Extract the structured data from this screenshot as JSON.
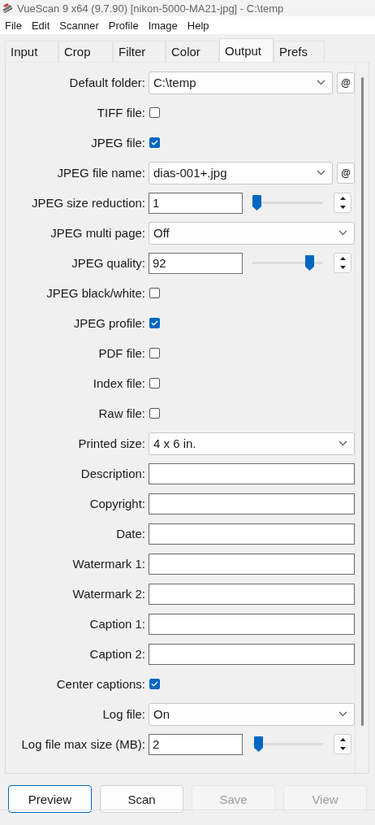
{
  "window": {
    "title": "VueScan 9 x64 (9.7.90) [nikon-5000-MA21-jpg] - C:\\temp"
  },
  "menu": [
    "File",
    "Edit",
    "Scanner",
    "Profile",
    "Image",
    "Help"
  ],
  "tabs": [
    {
      "label": "Input",
      "selected": false
    },
    {
      "label": "Crop",
      "selected": false
    },
    {
      "label": "Filter",
      "selected": false
    },
    {
      "label": "Color",
      "selected": false
    },
    {
      "label": "Output",
      "selected": true
    },
    {
      "label": "Prefs",
      "selected": false
    }
  ],
  "fields": [
    {
      "kind": "select",
      "label": "Default folder:",
      "value": "C:\\temp",
      "side_button": "@"
    },
    {
      "kind": "checkbox",
      "label": "TIFF file:",
      "checked": false
    },
    {
      "kind": "checkbox",
      "label": "JPEG file:",
      "checked": true
    },
    {
      "kind": "select",
      "label": "JPEG file name:",
      "value": "dias-001+.jpg",
      "side_button": "@"
    },
    {
      "kind": "number",
      "label": "JPEG size reduction:",
      "value": "1",
      "level": 0
    },
    {
      "kind": "select",
      "label": "JPEG multi page:",
      "value": "Off"
    },
    {
      "kind": "number",
      "label": "JPEG quality:",
      "value": "92",
      "level": 0.86
    },
    {
      "kind": "checkbox",
      "label": "JPEG black/white:",
      "checked": false
    },
    {
      "kind": "checkbox",
      "label": "JPEG profile:",
      "checked": true
    },
    {
      "kind": "checkbox",
      "label": "PDF file:",
      "checked": false
    },
    {
      "kind": "checkbox",
      "label": "Index file:",
      "checked": false
    },
    {
      "kind": "checkbox",
      "label": "Raw file:",
      "checked": false
    },
    {
      "kind": "select",
      "label": "Printed size:",
      "value": "4 x 6 in."
    },
    {
      "kind": "text",
      "label": "Description:"
    },
    {
      "kind": "text",
      "label": "Copyright:"
    },
    {
      "kind": "text",
      "label": "Date:"
    },
    {
      "kind": "text",
      "label": "Watermark 1:"
    },
    {
      "kind": "text",
      "label": "Watermark 2:"
    },
    {
      "kind": "text",
      "label": "Caption 1:"
    },
    {
      "kind": "text",
      "label": "Caption 2:"
    },
    {
      "kind": "checkbox",
      "label": "Center captions:",
      "checked": true
    },
    {
      "kind": "select",
      "label": "Log file:",
      "value": "On"
    },
    {
      "kind": "number",
      "label": "Log file max size (MB):",
      "value": "2",
      "level": 0.02
    }
  ],
  "buttons": [
    {
      "label": "Preview",
      "focused": true,
      "disabled": false
    },
    {
      "label": "Scan",
      "focused": false,
      "disabled": false
    },
    {
      "label": "Save",
      "focused": false,
      "disabled": true
    },
    {
      "label": "View",
      "focused": false,
      "disabled": true
    }
  ]
}
